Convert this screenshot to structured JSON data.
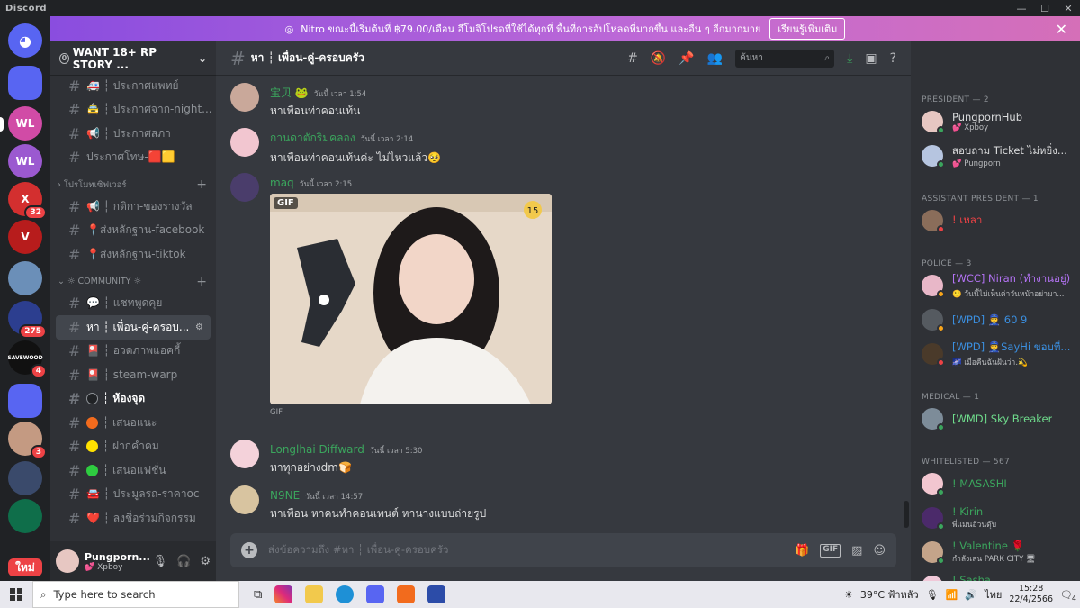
{
  "app": {
    "title": "Discord"
  },
  "nitro_banner": {
    "text": "Nitro ขณะนี้เริ่มต้นที่ ฿79.00/เดือน อีโมจิโปรดที่ใช้ได้ทุกที่ พื้นที่การอัปโหลดที่มากขึ้น และอื่น ๆ อีกมากมาย",
    "button": "เรียนรู้เพิ่มเติม"
  },
  "guilds": [
    {
      "label": "",
      "badge": "",
      "color": "#5865f2"
    },
    {
      "label": "",
      "badge": "",
      "color": "#5865f2"
    },
    {
      "label": "WL",
      "badge": "",
      "color": "#d14ba6"
    },
    {
      "label": "WL",
      "badge": "",
      "color": "#9b59d0"
    },
    {
      "label": "X",
      "badge": "32",
      "color": "#d32f2f"
    },
    {
      "label": "V",
      "badge": "",
      "color": "#b71c1c"
    },
    {
      "label": "",
      "badge": "",
      "color": "#6b8fb8"
    },
    {
      "label": "",
      "badge": "275",
      "color": "#2c3e8f"
    },
    {
      "label": "SAVEWOOD",
      "badge": "4",
      "color": "#111111"
    },
    {
      "label": "",
      "badge": "",
      "color": "#5865f2"
    },
    {
      "label": "",
      "badge": "3",
      "color": "#c49a82"
    },
    {
      "label": "",
      "badge": "",
      "color": "#3a4a6b"
    },
    {
      "label": "",
      "badge": "",
      "color": "#0f6e4a"
    },
    {
      "label": "ใหม่",
      "badge": "",
      "color": "#ed4245"
    }
  ],
  "server": {
    "name": "WANT 18+ RP STORY ...",
    "boost": "0"
  },
  "channels_top": [
    {
      "name": "🚑 ┆ ประกาศแพทย์",
      "state": "normal"
    },
    {
      "name": "🚖 ┆ ประกาศจาก-night...",
      "state": "normal"
    },
    {
      "name": "📢 ┆ ประกาศสภา",
      "state": "normal"
    },
    {
      "name": "ประกาศโทษ-🟥🟨",
      "state": "normal"
    }
  ],
  "category_promo": "โปรโมทเซิฟเวอร์",
  "channels_promo": [
    {
      "name": "📢 ┆ กติกา-ของรางวัล",
      "state": "normal"
    },
    {
      "name": "📍ส่งหลักฐาน-facebook",
      "state": "normal"
    },
    {
      "name": "📍ส่งหลักฐาน-tiktok",
      "state": "normal"
    }
  ],
  "category_community": "☼ COMMUNITY ☼",
  "channels_community": [
    {
      "name": "💬 ┆ แชทพูดคุย",
      "state": "normal",
      "dot": ""
    },
    {
      "name": "หา ┆ เพื่อน-คู่-ครอบ...",
      "state": "active",
      "dot": ""
    },
    {
      "name": "🎴 ┆ อวดภาพแอคกี้",
      "state": "normal",
      "dot": ""
    },
    {
      "name": "🎴 ┆ steam-warp",
      "state": "normal",
      "dot": ""
    },
    {
      "name": "┆ ห้องจุด",
      "state": "unread",
      "dot": "#202225"
    },
    {
      "name": "┆ เสนอแนะ",
      "state": "normal",
      "dot": "#f26b1d"
    },
    {
      "name": "┆ ฝากคำคม",
      "state": "normal",
      "dot": "#ffe100"
    },
    {
      "name": "┆ เสนอแฟชั่น",
      "state": "normal",
      "dot": "#2ecc40"
    },
    {
      "name": "🚘 ┆ ประมูลรถ-ราคาoc",
      "state": "normal",
      "dot": ""
    },
    {
      "name": "❤️ ┆ ลงชื่อร่วมกิจกรรม",
      "state": "normal",
      "dot": ""
    }
  ],
  "user": {
    "name": "Pungporn...",
    "status": "💕 Xpboy"
  },
  "chat": {
    "channel_title": "หา ┆ เพื่อน-คู่-ครอบครัว",
    "search_placeholder": "ค้นหา",
    "composer_placeholder": "ส่งข้อความถึง #หา ┆ เพื่อน-คู่-ครอบครัว",
    "messages": [
      {
        "author": "宝贝 🐸",
        "author_color": "#3ba55d",
        "time": "วันนี้ เวลา 1:54",
        "text": "หาเพื่อนท่าคอนเท้น",
        "avatar_color": "#c9a89a"
      },
      {
        "author": "กานดาตักริมคลอง",
        "author_color": "#3ba55d",
        "time": "วันนี้ เวลา 2:14",
        "text": "หาเพื่อนท่าคอนเท้นค่ะ ไม่ไหวแล้ว🥺",
        "avatar_color": "#f2c6d0"
      },
      {
        "author": "maq",
        "author_color": "#3ba55d",
        "time": "วันนี้ เวลา 2:15",
        "text": "",
        "avatar_color": "#4a3d6b",
        "gif_label": "GIF",
        "gif_caption": "GIF"
      },
      {
        "author": "Longlhai Diffward",
        "author_color": "#3ba55d",
        "time": "วันนี้ เวลา 5:30",
        "text": "หาทุกอย่างdm🍞",
        "avatar_color": "#f4d2da"
      },
      {
        "author": "N9NE",
        "author_color": "#3ba55d",
        "time": "วันนี้ เวลา 14:57",
        "text": "หาเพื่อน หาคนทำคอนเทนต์ หานางแบบถ่ายรูป",
        "avatar_color": "#d8c4a0"
      }
    ]
  },
  "members": {
    "groups": [
      {
        "title": "PRESIDENT — 2",
        "items": [
          {
            "name": "PungpornHub",
            "status": "💕 Xpboy",
            "color": "#dcddde",
            "avatar": "#e7c7c2",
            "presence": "#3ba55d"
          },
          {
            "name": "สอบถาม Ticket ไม่หยิ่ง...",
            "status": "💕 Pungporn",
            "color": "#dcddde",
            "avatar": "#b6c5e0",
            "presence": "#3ba55d"
          }
        ]
      },
      {
        "title": "ASSISTANT PRESIDENT — 1",
        "items": [
          {
            "name": "! เหลา",
            "status": "",
            "color": "#ed4245",
            "avatar": "#8a6d5a",
            "presence": "#ed4245"
          }
        ]
      },
      {
        "title": "POLICE — 3",
        "items": [
          {
            "name": "[WCC] Niran (ทำงานอยู่)",
            "status": "🙂 วันนี้ไม่เห็นค่าวันหน้าอย่ามา...",
            "color": "#b473f5",
            "avatar": "#e8b7c8",
            "presence": "#faa61a"
          },
          {
            "name": "[WPD] 👮 60 9",
            "status": "",
            "color": "#3b8fe0",
            "avatar": "#555a60",
            "presence": "#faa61a"
          },
          {
            "name": "[WPD] 👮SayHi ขอบที่...",
            "status": "🌌 เมื่อคืนฉันฝันว่า.💫",
            "color": "#3b8fe0",
            "avatar": "#4a3a2a",
            "presence": "#ed4245"
          }
        ]
      },
      {
        "title": "MEDICAL — 1",
        "items": [
          {
            "name": "[WMD] Sky Breaker",
            "status": "",
            "color": "#6fdc8c",
            "avatar": "#7d8c99",
            "presence": "#3ba55d"
          }
        ]
      },
      {
        "title": "WHITELISTED — 567",
        "items": [
          {
            "name": "! MASASHI",
            "status": "",
            "color": "#3ba55d",
            "avatar": "#f2c6d0",
            "presence": "#3ba55d"
          },
          {
            "name": "! Kirin",
            "status": "พี่แมนอ้วนตุ๊บ",
            "color": "#3ba55d",
            "avatar": "#4b2a6a",
            "presence": "#3ba55d"
          },
          {
            "name": "! Valentine 🌹",
            "status": "กำลังเล่น PARK CITY 🖥",
            "color": "#3ba55d",
            "avatar": "#c4a48a",
            "presence": "#3ba55d"
          },
          {
            "name": "! Sasha",
            "status": "🌪 ขอบคุณนะที่เลิกกัน ปลดปล่...",
            "color": "#3ba55d",
            "avatar": "#f0c8d8",
            "presence": "#faa61a"
          }
        ]
      }
    ]
  },
  "taskbar": {
    "search_placeholder": "Type here to search",
    "weather": "39°C ฟ้าหลัว",
    "lang": "ไทย",
    "time": "15:28",
    "date": "22/4/2566",
    "notif_count": "4"
  }
}
